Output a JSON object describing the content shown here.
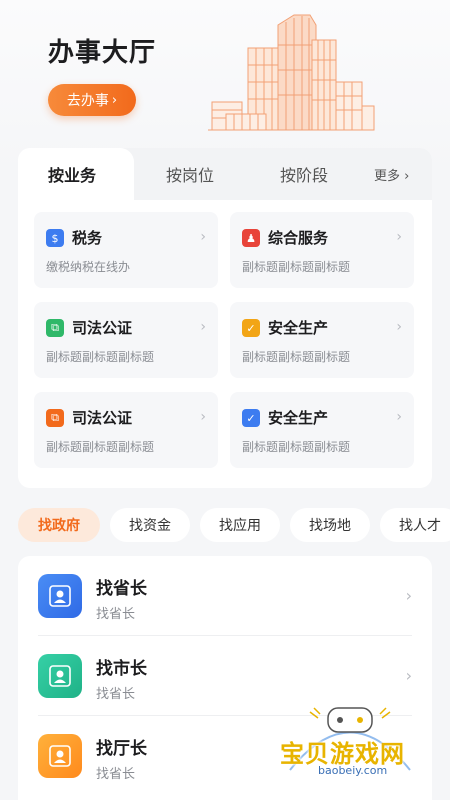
{
  "hero": {
    "title": "办事大厅",
    "button_label": "去办事",
    "button_chevron": "›"
  },
  "tabs": {
    "items": [
      "按业务",
      "按岗位",
      "按阶段"
    ],
    "more_label": "更多",
    "more_chevron": "›",
    "active_index": 0
  },
  "services": [
    {
      "title": "税务",
      "subtitle": "缴税纳税在线办",
      "icon": "tax-icon",
      "color": "#3d7cf0",
      "glyph": "$"
    },
    {
      "title": "综合服务",
      "subtitle": "副标题副标题副标题",
      "icon": "people-icon",
      "color": "#e8443a",
      "glyph": "♟"
    },
    {
      "title": "司法公证",
      "subtitle": "副标题副标题副标题",
      "icon": "judicial-icon",
      "color": "#2fb869",
      "glyph": "⧉"
    },
    {
      "title": "安全生产",
      "subtitle": "副标题副标题副标题",
      "icon": "shield-icon",
      "color": "#f2a516",
      "glyph": "✓"
    },
    {
      "title": "司法公证",
      "subtitle": "副标题副标题副标题",
      "icon": "judicial-icon",
      "color": "#f26a1c",
      "glyph": "⧉"
    },
    {
      "title": "安全生产",
      "subtitle": "副标题副标题副标题",
      "icon": "shield-icon",
      "color": "#3d7cf0",
      "glyph": "✓"
    }
  ],
  "chevron": "›",
  "chips": [
    "找政府",
    "找资金",
    "找应用",
    "找场地",
    "找人才"
  ],
  "chips_active_index": 0,
  "list": [
    {
      "title": "找省长",
      "subtitle": "找省长",
      "color_from": "#4a8df5",
      "color_to": "#2f6ae6"
    },
    {
      "title": "找市长",
      "subtitle": "找省长",
      "color_from": "#36d0a6",
      "color_to": "#1fb287"
    },
    {
      "title": "找厅长",
      "subtitle": "找省长",
      "color_from": "#ffb13b",
      "color_to": "#ff8a1d"
    }
  ],
  "watermark": {
    "text": "宝贝游戏网",
    "url": "baobeiy.com"
  }
}
